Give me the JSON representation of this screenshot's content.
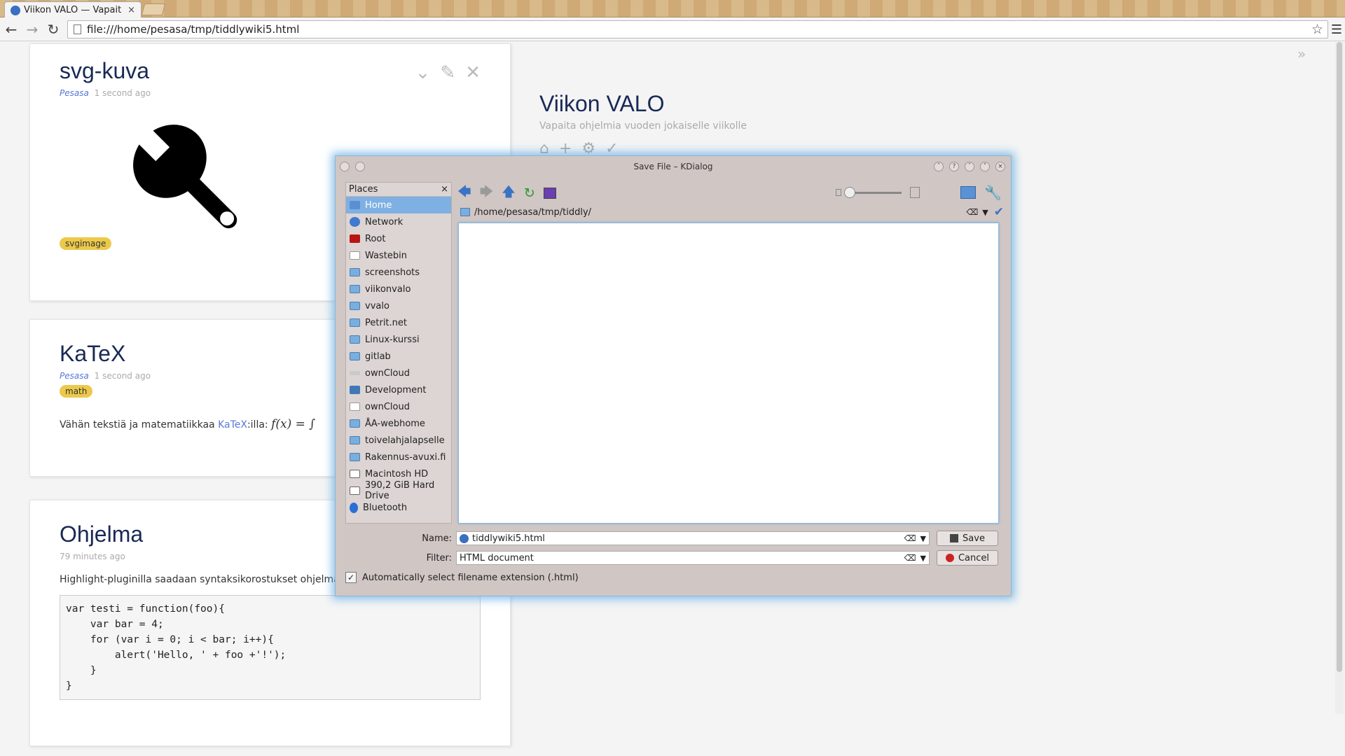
{
  "browser": {
    "tab_title": "Viikon VALO — Vapait",
    "tab_close": "×",
    "url": "file:///home/pesasa/tmp/tiddlywiki5.html"
  },
  "tiddlers": [
    {
      "title": "svg-kuva",
      "author": "Pesasa",
      "modified": "1 second ago",
      "tag": "svgimage"
    },
    {
      "title": "KaTeX",
      "author": "Pesasa",
      "modified": "1 second ago",
      "tag": "math",
      "text_before": "Vähän tekstiä ja matematiikkaa ",
      "link": "KaTeX",
      "text_after": ":illa: ",
      "formula": "f(x) = ∫"
    },
    {
      "title": "Ohjelma",
      "modified": "79 minutes ago",
      "text": "Highlight-pluginilla saadaan syntaksikorostukset ohjelmakoo",
      "code": [
        "var testi = function(foo){",
        "    var bar = 4;",
        "    for (var i = 0; i < bar; i++){",
        "        alert('Hello, ' + foo +'!');",
        "    }",
        "}"
      ]
    }
  ],
  "sidebar": {
    "title": "Viikon VALO",
    "subtitle": "Vapaita ohjelmia vuoden jokaiselle viikolle"
  },
  "dialog": {
    "title": "Save File – KDialog",
    "places_label": "Places",
    "places": [
      {
        "label": "Home",
        "icon": "home-icon"
      },
      {
        "label": "Network",
        "icon": "network-icon"
      },
      {
        "label": "Root",
        "icon": "root-icon"
      },
      {
        "label": "Wastebin",
        "icon": "wastebin-icon"
      },
      {
        "label": "screenshots",
        "icon": "folder-icon"
      },
      {
        "label": "viikonvalo",
        "icon": "folder-icon"
      },
      {
        "label": "vvalo",
        "icon": "folder-icon"
      },
      {
        "label": "Petrit.net",
        "icon": "folder-icon"
      },
      {
        "label": "Linux-kurssi",
        "icon": "folder-icon"
      },
      {
        "label": "gitlab",
        "icon": "folder-icon"
      },
      {
        "label": "ownCloud",
        "icon": "cloud-icon"
      },
      {
        "label": "Development",
        "icon": "development-icon"
      },
      {
        "label": "ownCloud",
        "icon": "owncloud-icon"
      },
      {
        "label": "ÅA-webhome",
        "icon": "folder-icon"
      },
      {
        "label": "toivelahjalapselle",
        "icon": "folder-icon"
      },
      {
        "label": "Rakennus-avuxi.fi",
        "icon": "folder-icon"
      },
      {
        "label": "Macintosh HD",
        "icon": "disk-icon"
      },
      {
        "label": "390,2 GiB Hard Drive",
        "icon": "harddrive-icon"
      },
      {
        "label": "Bluetooth",
        "icon": "bluetooth-icon"
      }
    ],
    "selected_place": "Home",
    "path": "/home/pesasa/tmp/tiddly/",
    "name_label": "Name:",
    "name_value": "tiddlywiki5.html",
    "filter_label": "Filter:",
    "filter_value": "HTML document",
    "save_label": "Save",
    "cancel_label": "Cancel",
    "auto_ext_label": "Automatically select filename extension (.html)",
    "auto_ext_checked": true
  },
  "colors": {
    "accent": "#62abe6",
    "title_color": "#182955",
    "tag_color": "#ecc94b",
    "link_color": "#5778d8"
  }
}
